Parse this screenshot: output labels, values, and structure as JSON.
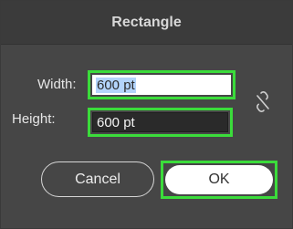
{
  "dialog": {
    "title": "Rectangle"
  },
  "fields": {
    "width": {
      "label": "Width:",
      "value": "600 pt"
    },
    "height": {
      "label": "Height:",
      "value": "600 pt"
    }
  },
  "constrain": {
    "icon": "broken-link-icon",
    "linked": false
  },
  "buttons": {
    "cancel_label": "Cancel",
    "ok_label": "OK"
  },
  "colors": {
    "highlight": "#3bdc3b",
    "selection": "#b3d4fb",
    "dialog_bg": "#464646"
  }
}
